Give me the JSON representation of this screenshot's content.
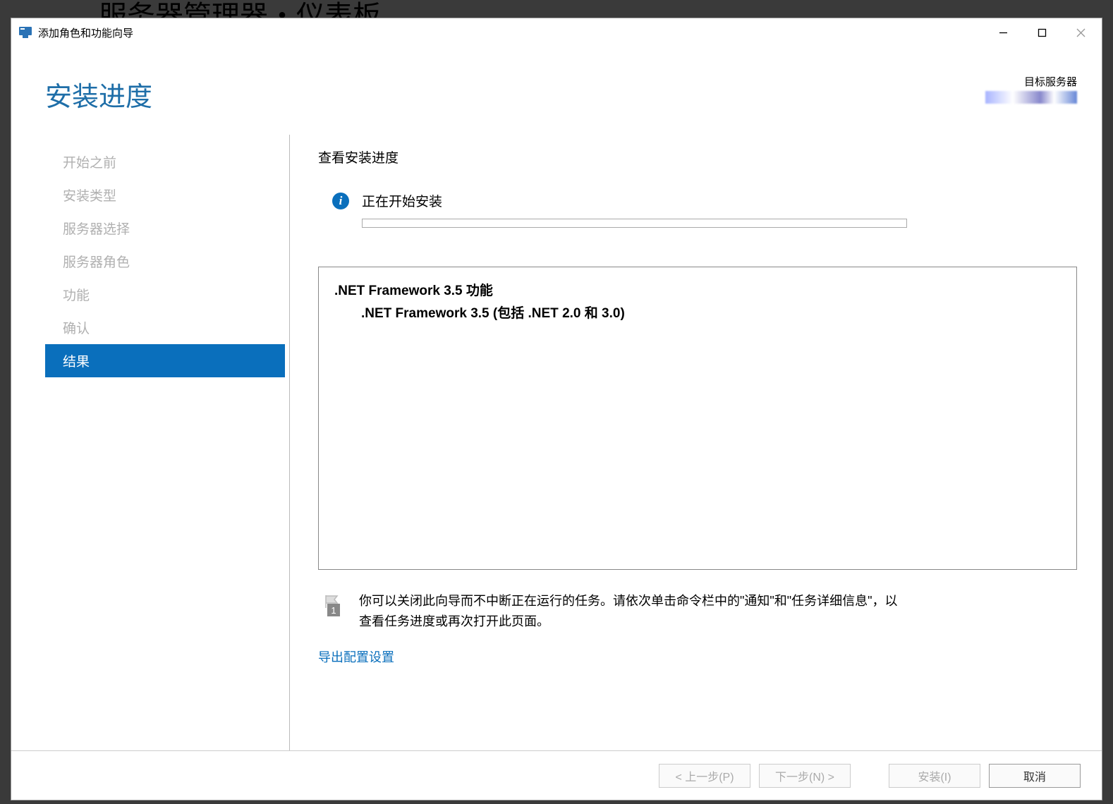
{
  "background": {
    "text": "服务器管理器・仪表板"
  },
  "titlebar": {
    "title": "添加角色和功能向导"
  },
  "header": {
    "page_title": "安装进度",
    "target_label": "目标服务器"
  },
  "sidebar": {
    "steps": [
      {
        "label": "开始之前",
        "active": false
      },
      {
        "label": "安装类型",
        "active": false
      },
      {
        "label": "服务器选择",
        "active": false
      },
      {
        "label": "服务器角色",
        "active": false
      },
      {
        "label": "功能",
        "active": false
      },
      {
        "label": "确认",
        "active": false
      },
      {
        "label": "结果",
        "active": true
      }
    ]
  },
  "main": {
    "section_title": "查看安装进度",
    "status_text": "正在开始安装",
    "details": {
      "line1": ".NET Framework 3.5 功能",
      "line2": ".NET Framework 3.5 (包括 .NET 2.0 和 3.0)"
    },
    "flag_count": "1",
    "note_text": "你可以关闭此向导而不中断正在运行的任务。请依次单击命令栏中的\"通知\"和\"任务详细信息\"，以查看任务进度或再次打开此页面。",
    "export_link": "导出配置设置"
  },
  "buttons": {
    "previous": "< 上一步(P)",
    "next": "下一步(N) >",
    "install": "安装(I)",
    "cancel": "取消"
  }
}
